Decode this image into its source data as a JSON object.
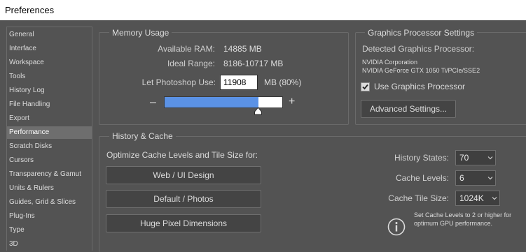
{
  "window": {
    "title": "Preferences"
  },
  "sidebar": {
    "items": [
      {
        "label": "General"
      },
      {
        "label": "Interface"
      },
      {
        "label": "Workspace"
      },
      {
        "label": "Tools"
      },
      {
        "label": "History Log"
      },
      {
        "label": "File Handling"
      },
      {
        "label": "Export"
      },
      {
        "label": "Performance",
        "selected": true
      },
      {
        "label": "Scratch Disks"
      },
      {
        "label": "Cursors"
      },
      {
        "label": "Transparency & Gamut"
      },
      {
        "label": "Units & Rulers"
      },
      {
        "label": "Guides, Grid & Slices"
      },
      {
        "label": "Plug-Ins"
      },
      {
        "label": "Type"
      },
      {
        "label": "3D"
      }
    ]
  },
  "memory": {
    "title": "Memory Usage",
    "available_label": "Available RAM:",
    "available_value": "14885 MB",
    "ideal_label": "Ideal Range:",
    "ideal_value": "8186-10717 MB",
    "let_label": "Let Photoshop Use:",
    "let_value": "11908",
    "let_unit": "MB (80%)",
    "minus": "–",
    "plus": "+",
    "slider_fraction": 0.8,
    "slider_color": "#5b92e5"
  },
  "gpu": {
    "title": "Graphics Processor Settings",
    "detected_label": "Detected Graphics Processor:",
    "vendor": "NVIDIA Corporation",
    "model": "NVIDIA GeForce GTX 1050 Ti/PCIe/SSE2",
    "use_label": "Use Graphics Processor",
    "use_checked": true,
    "advanced_button": "Advanced Settings..."
  },
  "history": {
    "title": "History & Cache",
    "optimize_label": "Optimize Cache Levels and Tile Size for:",
    "btn_web": "Web / UI Design",
    "btn_default": "Default / Photos",
    "btn_huge": "Huge Pixel Dimensions",
    "states_label": "History States:",
    "states_value": "70",
    "levels_label": "Cache Levels:",
    "levels_value": "6",
    "tile_label": "Cache Tile Size:",
    "tile_value": "1024K",
    "info_line1": "Set Cache Levels to 2 or higher for",
    "info_line2": "optimum GPU performance.",
    "info_icon": "info-icon"
  }
}
